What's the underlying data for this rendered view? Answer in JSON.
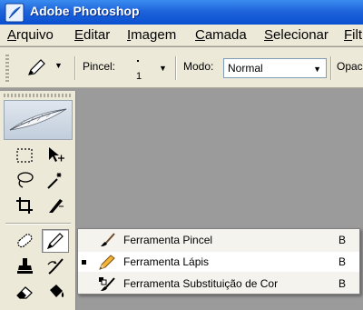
{
  "window": {
    "title": "Adobe Photoshop"
  },
  "menubar": {
    "items": [
      {
        "label": "Arquivo",
        "mnemonic": "A",
        "rest": "rquivo"
      },
      {
        "label": "Editar",
        "mnemonic": "E",
        "rest": "ditar"
      },
      {
        "label": "Imagem",
        "mnemonic": "I",
        "rest": "magem"
      },
      {
        "label": "Camada",
        "mnemonic": "C",
        "rest": "amada"
      },
      {
        "label": "Selecionar",
        "mnemonic": "S",
        "rest": "elecionar"
      },
      {
        "label": "Filt",
        "mnemonic": "F",
        "rest": "ilt"
      }
    ]
  },
  "options": {
    "brush_label": "Pincel:",
    "brush_size": "1",
    "mode_label": "Modo:",
    "mode_value": "Normal",
    "opacity_label_partial": "Opac"
  },
  "flyout": {
    "items": [
      {
        "label": "Ferramenta Pincel",
        "shortcut": "B",
        "icon": "brush-icon",
        "selected": false
      },
      {
        "label": "Ferramenta Lápis",
        "shortcut": "B",
        "icon": "pencil-icon",
        "selected": true
      },
      {
        "label": "Ferramenta Substituição de Cor",
        "shortcut": "B",
        "icon": "color-replacement-icon",
        "selected": false
      }
    ]
  },
  "colors": {
    "titlebar": "#1f64db",
    "chrome": "#ece9d8",
    "canvas": "#9b9b9b"
  }
}
